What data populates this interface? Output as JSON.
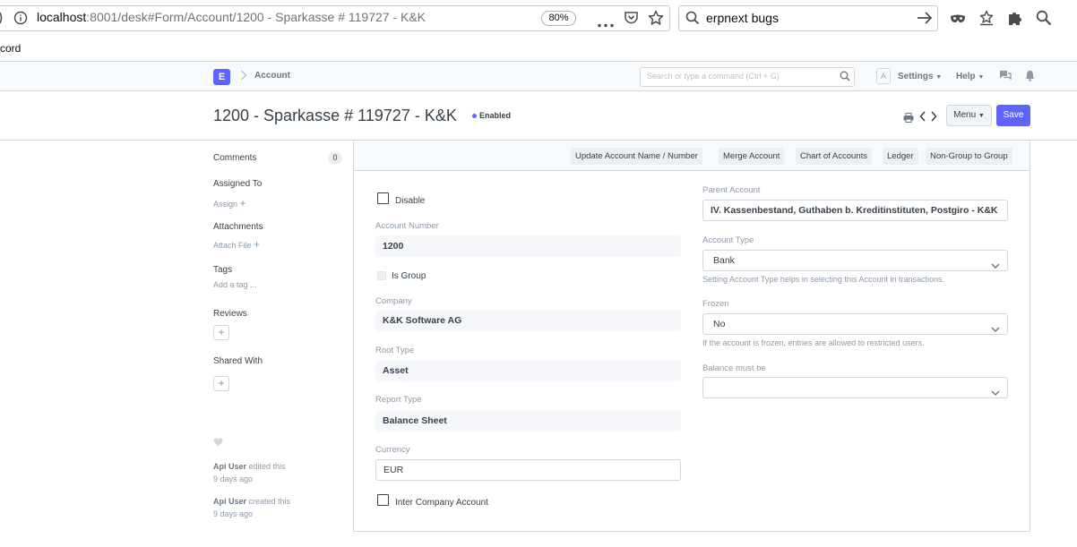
{
  "browser": {
    "url_host": "localhost",
    "url_path": ":8001/desk#Form/Account/1200 - Sparkasse # 119727 - K&K",
    "zoom": "80%",
    "search_query": "erpnext bugs",
    "bookmark_text": "cord"
  },
  "navbar": {
    "logo_letter": "E",
    "breadcrumb": "Account",
    "search_placeholder": "Search or type a command (Ctrl + G)",
    "avatar_letter": "A",
    "settings_label": "Settings",
    "help_label": "Help"
  },
  "page": {
    "title": "1200 - Sparkasse # 119727 - K&K",
    "status": "Enabled",
    "menu_label": "Menu",
    "save_label": "Save"
  },
  "sidebar": {
    "comments_label": "Comments",
    "comments_count": "0",
    "assigned_to_label": "Assigned To",
    "assign_link": "Assign",
    "attachments_label": "Attachments",
    "attach_link": "Attach File",
    "tags_label": "Tags",
    "add_tag_link": "Add a tag ...",
    "reviews_label": "Reviews",
    "shared_with_label": "Shared With",
    "timeline": [
      {
        "user": "Api User",
        "action": "edited this",
        "when": "9 days ago"
      },
      {
        "user": "Api User",
        "action": "created this",
        "when": "9 days ago"
      }
    ]
  },
  "toolbar": {
    "buttons": [
      "Update Account Name / Number",
      "Merge Account",
      "Chart of Accounts",
      "Ledger",
      "Non-Group to Group"
    ]
  },
  "form": {
    "disable_label": "Disable",
    "account_number_label": "Account Number",
    "account_number": "1200",
    "is_group_label": "Is Group",
    "company_label": "Company",
    "company": "K&K Software AG",
    "root_type_label": "Root Type",
    "root_type": "Asset",
    "report_type_label": "Report Type",
    "report_type": "Balance Sheet",
    "currency_label": "Currency",
    "currency": "EUR",
    "inter_company_label": "Inter Company Account",
    "parent_account_label": "Parent Account",
    "parent_account": "IV. Kassenbestand, Guthaben b. Kreditinstituten, Postgiro - K&K",
    "account_type_label": "Account Type",
    "account_type": "Bank",
    "account_type_help": "Setting Account Type helps in selecting this Account in transactions.",
    "frozen_label": "Frozen",
    "frozen": "No",
    "frozen_help": "If the account is frozen, entries are allowed to restricted users.",
    "balance_label": "Balance must be",
    "balance": ""
  }
}
